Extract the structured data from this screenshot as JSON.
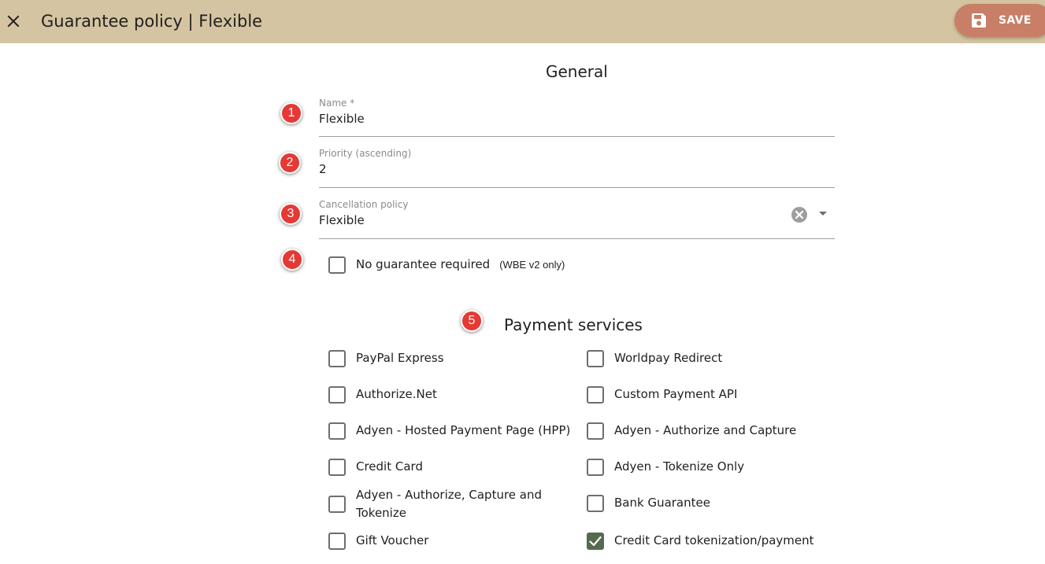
{
  "header": {
    "title": "Guarantee policy | Flexible",
    "save_label": "SAVE"
  },
  "general": {
    "title": "General",
    "name": {
      "label": "Name *",
      "value": "Flexible"
    },
    "priority": {
      "label": "Priority (ascending)",
      "value": "2"
    },
    "cancellation": {
      "label": "Cancellation policy",
      "value": "Flexible"
    },
    "no_guarantee": {
      "label": "No guarantee required",
      "note": "(WBE v2 only)",
      "checked": false
    }
  },
  "payment": {
    "title": "Payment services",
    "left": [
      {
        "label": "PayPal Express",
        "checked": false
      },
      {
        "label": "Authorize.Net",
        "checked": false
      },
      {
        "label": "Adyen - Hosted Payment Page (HPP)",
        "checked": false
      },
      {
        "label": "Credit Card",
        "checked": false
      },
      {
        "label": "Adyen - Authorize, Capture and Tokenize",
        "checked": false
      },
      {
        "label": "Gift Voucher",
        "checked": false
      }
    ],
    "right": [
      {
        "label": "Worldpay Redirect",
        "checked": false
      },
      {
        "label": "Custom Payment API",
        "checked": false
      },
      {
        "label": "Adyen - Authorize and Capture",
        "checked": false
      },
      {
        "label": "Adyen - Tokenize Only",
        "checked": false
      },
      {
        "label": "Bank Guarantee",
        "checked": false
      },
      {
        "label": "Credit Card tokenization/payment",
        "checked": true
      }
    ]
  },
  "markers": [
    "1",
    "2",
    "3",
    "4",
    "5"
  ],
  "colors": {
    "toolbar": "#d4c4a1",
    "save_button": "#c97e67",
    "checkbox_checked": "#556a50",
    "marker": "#e53935"
  }
}
